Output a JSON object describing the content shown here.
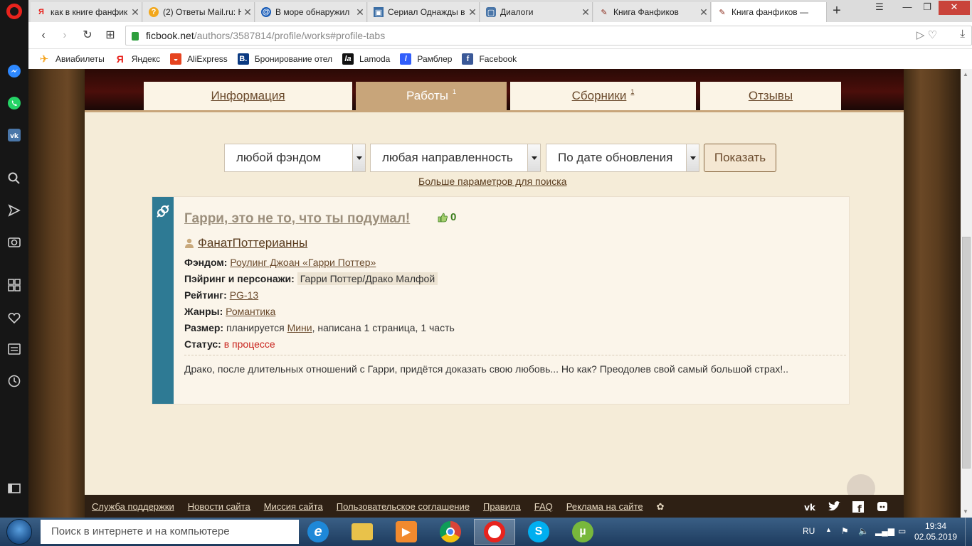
{
  "tabs": [
    {
      "title": "как в книге фанфик",
      "favicon": "Я",
      "favicon_color": "#e8231d",
      "active": false
    },
    {
      "title": "(2) Ответы Mail.ru: Н",
      "favicon": "?",
      "favicon_color": "#f2a71b",
      "active": false
    },
    {
      "title": "В море обнаружил",
      "favicon": "@",
      "favicon_color": "#1a5db8",
      "active": false
    },
    {
      "title": "Сериал Однажды в",
      "favicon": "▣",
      "favicon_color": "#3b6ea5",
      "active": false
    },
    {
      "title": "Диалоги",
      "favicon": "▢",
      "favicon_color": "#4a76a8",
      "active": false
    },
    {
      "title": "Книга Фанфиков",
      "favicon": "✎",
      "favicon_color": "#8a2a1a",
      "active": false
    },
    {
      "title": "Книга фанфиков — ",
      "favicon": "✎",
      "favicon_color": "#8a2a1a",
      "active": true
    }
  ],
  "address": {
    "host": "ficbook.net",
    "path": "/authors/3587814/profile/works#profile-tabs"
  },
  "bookmarks": [
    {
      "label": "Авиабилеты",
      "icon": "plane-icon",
      "color": "#f4a21b"
    },
    {
      "label": "Яндекс",
      "icon": "yandex-icon",
      "color": "#e8231d"
    },
    {
      "label": "AliExpress",
      "icon": "aliexpress-icon",
      "color": "#e6431f"
    },
    {
      "label": "Бронирование отел",
      "icon": "booking-icon",
      "color": "#0b3a82"
    },
    {
      "label": "Lamoda",
      "icon": "lamoda-icon",
      "color": "#111111"
    },
    {
      "label": "Рамблер",
      "icon": "rambler-icon",
      "color": "#315efb"
    },
    {
      "label": "Facebook",
      "icon": "facebook-icon",
      "color": "#3b5998"
    }
  ],
  "page_tabs": [
    {
      "label": "Информация",
      "count": "",
      "active": false
    },
    {
      "label": "Работы",
      "count": "1",
      "active": true
    },
    {
      "label": "Сборники",
      "count": "1",
      "active": false
    },
    {
      "label": "Отзывы",
      "count": "",
      "active": false
    }
  ],
  "filters": {
    "fandom": "любой фэндом",
    "direction": "любая направленность",
    "sort": "По дате обновления",
    "show_button": "Показать",
    "more_params": "Больше параметров для поиска"
  },
  "fic": {
    "title": "Гарри, это не то, что ты подумал!",
    "likes": "0",
    "author": "ФанатПоттерианны",
    "fandom_label": "Фэндом:",
    "fandom": "Роулинг Джоан «Гарри Поттер»",
    "pairing_label": "Пэйринг и персонажи:",
    "pairing": "Гарри Поттер/Драко Малфой",
    "rating_label": "Рейтинг:",
    "rating": "PG-13",
    "genres_label": "Жанры:",
    "genres": "Романтика",
    "size_label": "Размер:",
    "size_prefix": "планируется",
    "size_link": "Мини",
    "size_suffix": ", написана 1 страница, 1 часть",
    "status_label": "Статус:",
    "status": "в процессе",
    "description": "Драко, после длительных отношений с Гарри, придётся доказать свою любовь... Но как? Преодолев свой самый большой страх!.."
  },
  "footer_links": [
    "Служба поддержки",
    "Новости сайта",
    "Миссия сайта",
    "Пользовательское соглашение",
    "Правила",
    "FAQ",
    "Реклама на сайте"
  ],
  "taskbar": {
    "search_placeholder": "Поиск в интернете и на компьютере",
    "lang": "RU",
    "time": "19:34",
    "date": "02.05.2019"
  },
  "colors": {
    "opera_red": "#e8231d",
    "paper": "#f5ecd8",
    "accent_tan": "#c8a57a",
    "direction_teal": "#2e7a94",
    "status_red": "#c8231d"
  }
}
